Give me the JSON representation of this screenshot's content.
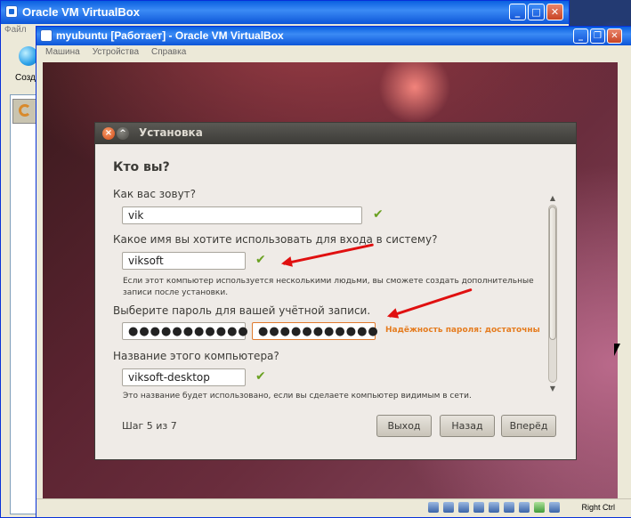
{
  "outer_window": {
    "title": "Oracle VM VirtualBox",
    "menu_file": "Файл",
    "toolbar_create": "Созда"
  },
  "inner_window": {
    "title": "myubuntu [Работает] - Oracle VM VirtualBox",
    "menu": [
      "Машина",
      "Устройства",
      "Справка"
    ],
    "host_key": "Right Ctrl"
  },
  "dialog": {
    "title": "Установка",
    "heading": "Кто вы?",
    "name_label": "Как вас зовут?",
    "name_value": "vik",
    "login_label": "Какое имя вы хотите использовать для входа в систему?",
    "login_value": "viksoft",
    "login_hint": "Если этот компьютер используется несколькими людьми, вы сможете создать дополнительные записи после установки.",
    "password_label": "Выберите пароль для вашей учётной записи.",
    "password_value": "●●●●●●●●●●●",
    "password_confirm_value": "●●●●●●●●●●●",
    "password_strength": "Надёжность пароля: достаточны",
    "hostname_label": "Название этого компьютера?",
    "hostname_value": "viksoft-desktop",
    "hostname_hint": "Это название будет использовано, если вы сделаете компьютер видимым в сети.",
    "step": "Шаг 5 из 7",
    "buttons": {
      "quit": "Выход",
      "back": "Назад",
      "forward": "Вперёд"
    }
  },
  "colors": {
    "accent_orange": "#e57c1f",
    "check_green": "#6aa121",
    "annotation_red": "#e01010",
    "ubuntu_title": "#3c3b37"
  }
}
